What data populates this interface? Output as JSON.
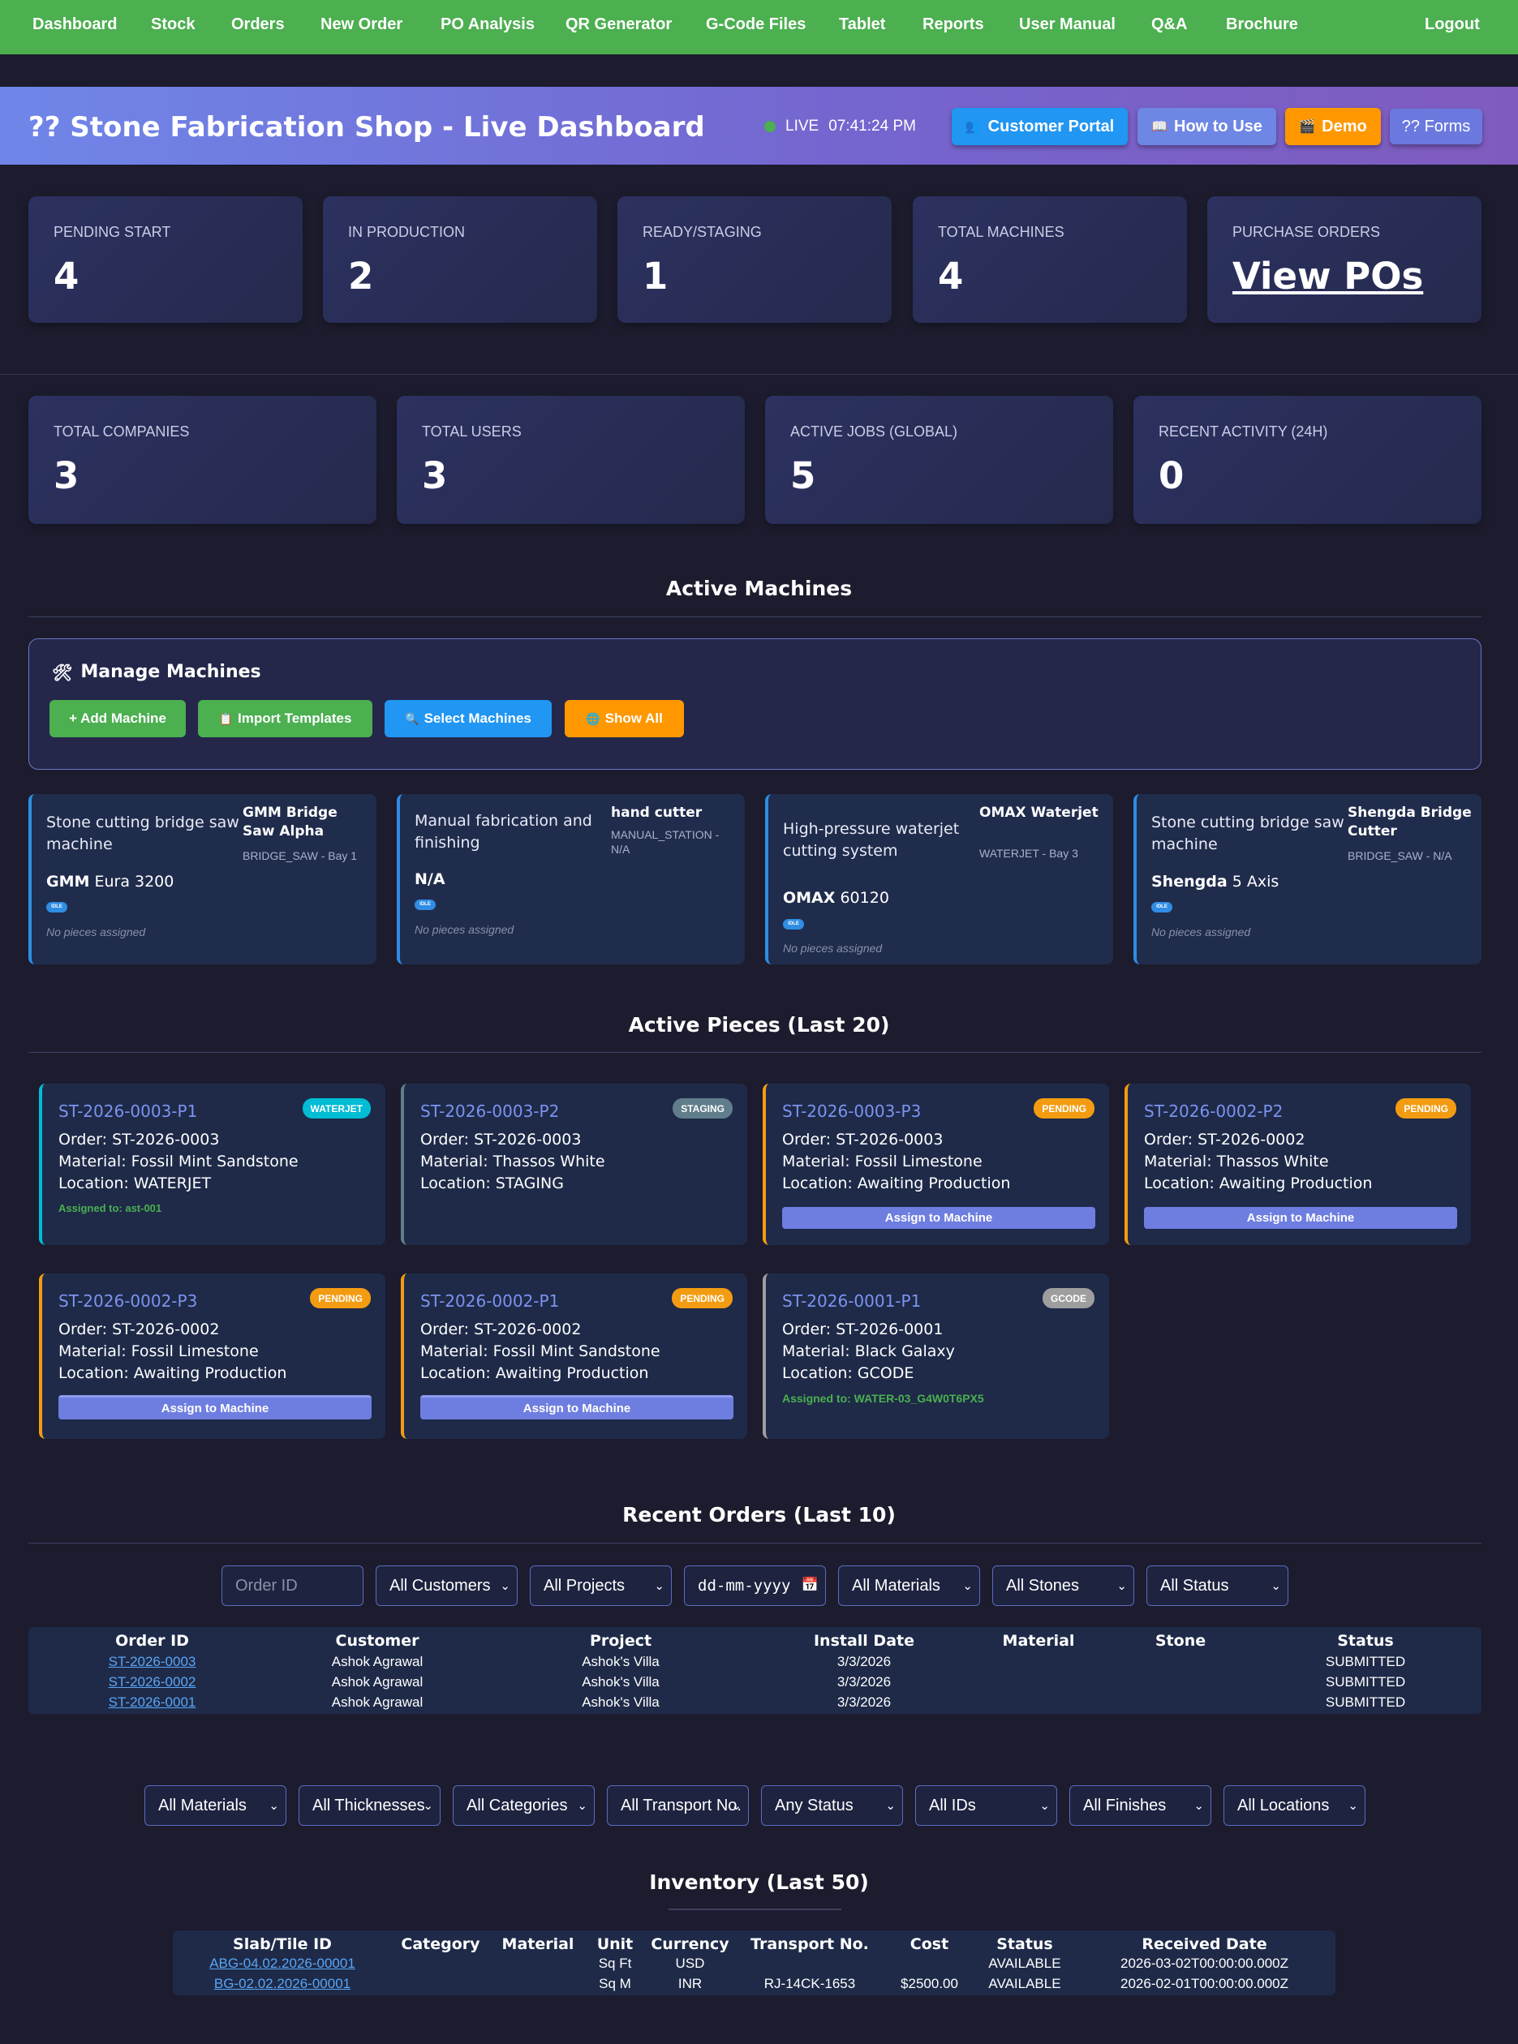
{
  "nav": {
    "items": [
      "Dashboard",
      "Stock",
      "Orders",
      "New Order",
      "PO Analysis",
      "QR Generator",
      "G-Code Files",
      "Tablet",
      "Reports",
      "User Manual",
      "Q&A",
      "Brochure"
    ],
    "logout": "Logout"
  },
  "header": {
    "title": "?? Stone Fabrication Shop - Live Dashboard",
    "live_label": "LIVE",
    "time": "07:41:24 PM",
    "buttons": {
      "customer_portal": "Customer Portal",
      "how_to_use": "How to Use",
      "demo": "Demo",
      "forms": "?? Forms"
    }
  },
  "stats_row1": [
    {
      "label": "Pending Start",
      "value": "4"
    },
    {
      "label": "In Production",
      "value": "2"
    },
    {
      "label": "Ready/Staging",
      "value": "1"
    },
    {
      "label": "Total Machines",
      "value": "4"
    },
    {
      "label": "Purchase Orders",
      "value": "View POs"
    }
  ],
  "stats_row2": [
    {
      "label": "Total Companies",
      "value": "3"
    },
    {
      "label": "Total Users",
      "value": "3"
    },
    {
      "label": "Active Jobs (Global)",
      "value": "5"
    },
    {
      "label": "Recent Activity (24h)",
      "value": "0"
    }
  ],
  "machines_section": {
    "title": "Active Machines",
    "manage_title": "Manage Machines",
    "buttons": {
      "add": "+ Add Machine",
      "import": "Import Templates",
      "select": "Select Machines",
      "show_all": "Show All"
    },
    "cards": [
      {
        "description": "Stone cutting bridge saw machine",
        "name": "GMM Bridge Saw Alpha",
        "type": "BRIDGE_SAW - Bay 1",
        "brand": "GMM",
        "model": "Eura 3200",
        "status": "IDLE",
        "pieces": "No pieces assigned"
      },
      {
        "description": "Manual fabrication and finishing",
        "name": "hand cutter",
        "type": "MANUAL_STATION - N/A",
        "brand": "N/A",
        "model": "",
        "status": "IDLE",
        "pieces": "No pieces assigned"
      },
      {
        "description": "High-pressure waterjet cutting system",
        "name": "OMAX Waterjet",
        "type": "WATERJET - Bay 3",
        "brand": "OMAX",
        "model": "60120",
        "status": "IDLE",
        "pieces": "No pieces assigned"
      },
      {
        "description": "Stone cutting bridge saw machine",
        "name": "Shengda Bridge Cutter",
        "type": "BRIDGE_SAW - N/A",
        "brand": "Shengda",
        "model": "5 Axis",
        "status": "IDLE",
        "pieces": "No pieces assigned"
      }
    ]
  },
  "pieces_section": {
    "title": "Active Pieces (Last 20)",
    "assign_label": "Assign to Machine",
    "cards": [
      {
        "id": "ST-2026-0003-P1",
        "badge": "WATERJET",
        "order": "Order: ST-2026-0003",
        "material": "Material: Fossil Mint Sandstone",
        "location": "Location: WATERJET",
        "assigned": "Assigned to: ast-001"
      },
      {
        "id": "ST-2026-0003-P2",
        "badge": "STAGING",
        "order": "Order: ST-2026-0003",
        "material": "Material: Thassos White",
        "location": "Location: STAGING"
      },
      {
        "id": "ST-2026-0003-P3",
        "badge": "PENDING",
        "order": "Order: ST-2026-0003",
        "material": "Material: Fossil Limestone",
        "location": "Location: Awaiting Production"
      },
      {
        "id": "ST-2026-0002-P2",
        "badge": "PENDING",
        "order": "Order: ST-2026-0002",
        "material": "Material: Thassos White",
        "location": "Location: Awaiting Production"
      },
      {
        "id": "ST-2026-0002-P3",
        "badge": "PENDING",
        "order": "Order: ST-2026-0002",
        "material": "Material: Fossil Limestone",
        "location": "Location: Awaiting Production"
      },
      {
        "id": "ST-2026-0002-P1",
        "badge": "PENDING",
        "order": "Order: ST-2026-0002",
        "material": "Material: Fossil Mint Sandstone",
        "location": "Location: Awaiting Production"
      },
      {
        "id": "ST-2026-0001-P1",
        "badge": "GCODE",
        "order": "Order: ST-2026-0001",
        "material": "Material: Black Galaxy",
        "location": "Location: GCODE",
        "assigned": "Assigned to: WATER-03_G4W0T6PX5"
      }
    ]
  },
  "orders_section": {
    "title": "Recent Orders (Last 10)",
    "filters": {
      "order_id_placeholder": "Order ID",
      "customers": "All Customers",
      "projects": "All Projects",
      "date_placeholder": "dd-mm-yyyy",
      "materials": "All Materials",
      "stones": "All Stones",
      "status": "All Status"
    },
    "columns": [
      "Order ID",
      "Customer",
      "Project",
      "Install Date",
      "Material",
      "Stone",
      "Status"
    ],
    "rows": [
      [
        "ST-2026-0003",
        "Ashok Agrawal",
        "Ashok's Villa",
        "3/3/2026",
        "",
        "",
        "SUBMITTED"
      ],
      [
        "ST-2026-0002",
        "Ashok Agrawal",
        "Ashok's Villa",
        "3/3/2026",
        "",
        "",
        "SUBMITTED"
      ],
      [
        "ST-2026-0001",
        "Ashok Agrawal",
        "Ashok's Villa",
        "3/3/2026",
        "",
        "",
        "SUBMITTED"
      ]
    ]
  },
  "inventory_section": {
    "title": "Inventory (Last 50)",
    "filters": [
      "All Materials",
      "All Thicknesses",
      "All Categories",
      "All Transport No.",
      "Any Status",
      "All IDs",
      "All Finishes",
      "All Locations"
    ],
    "columns": [
      "Slab/Tile ID",
      "Category",
      "Material",
      "Unit",
      "Currency",
      "Transport No.",
      "Cost",
      "Status",
      "Received Date"
    ],
    "rows": [
      [
        "ABG-04.02.2026-00001",
        "",
        "",
        "Sq Ft",
        "USD",
        "",
        "",
        "AVAILABLE",
        "2026-03-02T00:00:00.000Z"
      ],
      [
        "BG-02.02.2026-00001",
        "",
        "",
        "Sq M",
        "INR",
        "RJ-14CK-1653",
        "$2500.00",
        "AVAILABLE",
        "2026-02-01T00:00:00.000Z"
      ]
    ]
  },
  "colors": {
    "nav": "#4caf50",
    "background": "#1c1c2e",
    "customer_portal": "#2196f3",
    "how_to_use": "#6e86e4",
    "demo": "#ff9800",
    "waterjet_badge": "#00bcd4",
    "staging_badge": "#607d8b",
    "pending_badge": "#f39c12",
    "gcode_badge": "#9e9e9e",
    "link": "#5aa6f5"
  }
}
